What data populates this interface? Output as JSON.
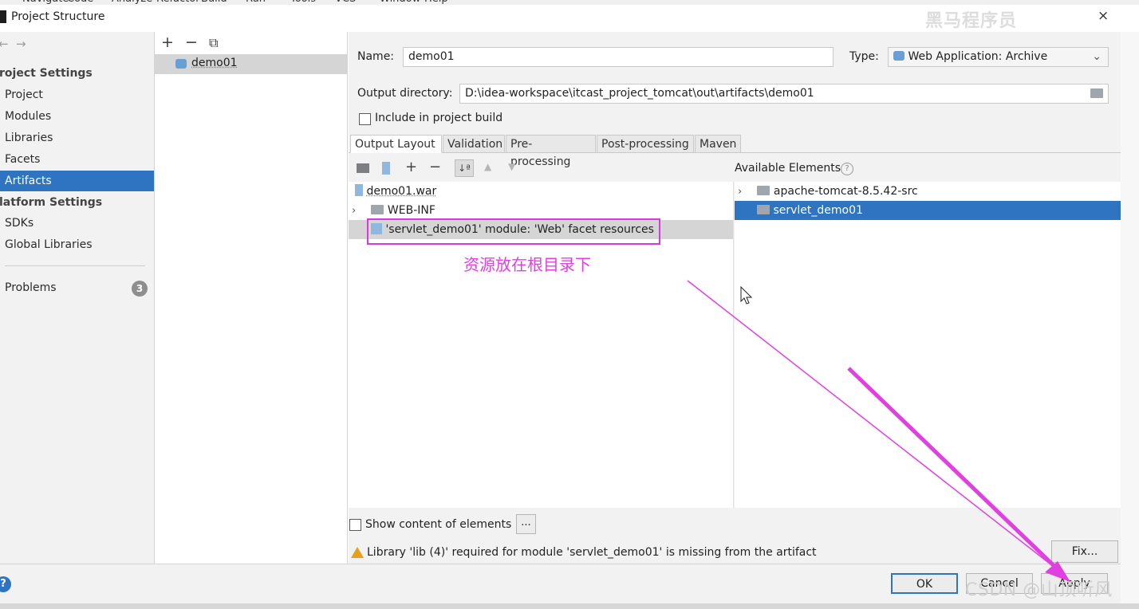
{
  "menu": {
    "items": [
      "Navigate",
      "Code",
      "Analyze",
      "Refactor",
      "Build",
      "Run",
      "Tools",
      "VCS",
      "Window",
      "Help"
    ]
  },
  "window": {
    "title": "Project Structure",
    "close": "×"
  },
  "watermark_top": "黑马程序员",
  "sidebar": {
    "back": "←",
    "forward": "→",
    "project_settings_header": "roject Settings",
    "items_project": [
      "Project",
      "Modules",
      "Libraries",
      "Facets",
      "Artifacts"
    ],
    "platform_settings_header": "latform Settings",
    "items_platform": [
      "SDKs",
      "Global Libraries"
    ],
    "problems_label": "Problems",
    "problems_count": "3",
    "selected": "Artifacts"
  },
  "artifacts": {
    "toolbar": {
      "add": "+",
      "remove": "−",
      "copy": "⧉"
    },
    "items": [
      "demo01"
    ]
  },
  "detail": {
    "name_label": "Name:",
    "name_value": "demo01",
    "type_label": "Type:",
    "type_value": "Web Application: Archive",
    "output_dir_label": "Output directory:",
    "output_dir_value": "D:\\idea-workspace\\itcast_project_tomcat\\out\\artifacts\\demo01",
    "include_build_label": "Include in project build",
    "tabs": [
      "Output Layout",
      "Validation",
      "Pre-processing",
      "Post-processing",
      "Maven"
    ],
    "active_tab": "Output Layout",
    "available_elements_label": "Available Elements",
    "layout_tree": {
      "root": "demo01.war",
      "webinf": "WEB-INF",
      "facet_resources": "'servlet_demo01' module: 'Web' facet resources"
    },
    "available_tree": {
      "item1": "apache-tomcat-8.5.42-src",
      "item2": "servlet_demo01"
    },
    "annotation": "资源放在根目录下",
    "show_content_label": "Show content of elements",
    "more_btn": "...",
    "warning_text": "Library 'lib (4)' required for module 'servlet_demo01' is missing from the artifact",
    "fix_btn": "Fix..."
  },
  "footer": {
    "help": "?",
    "ok": "OK",
    "cancel": "Cancel",
    "apply": "Apply"
  },
  "watermark_bottom": "CSDN @山顶听风",
  "colors": {
    "accent": "#2f74c0",
    "annotation": "#e040e0",
    "warning": "#e7a01e"
  }
}
